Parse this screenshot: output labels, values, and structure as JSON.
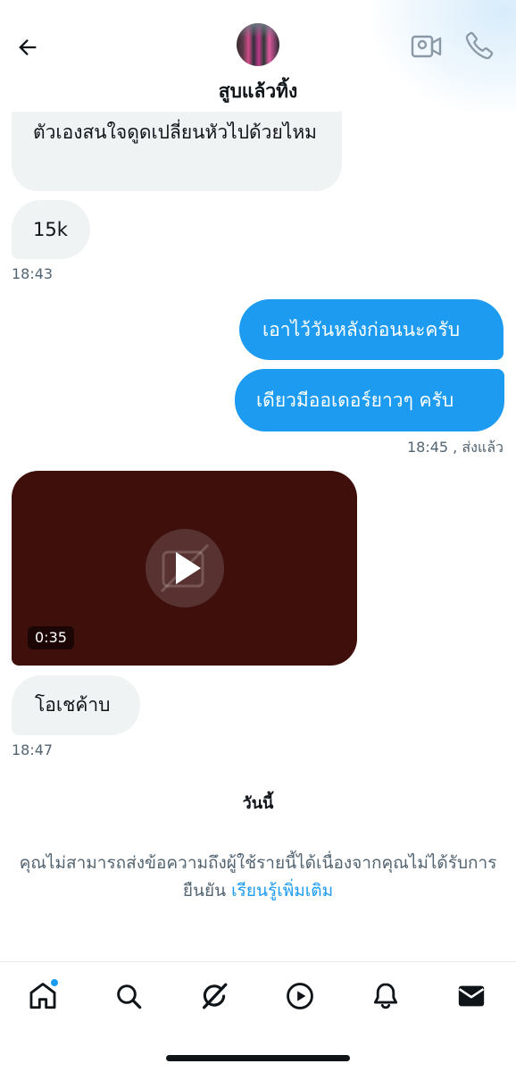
{
  "header": {
    "contact_name": "สูบแล้วทิ้ง",
    "back_icon": "arrow-left-icon",
    "video_call_icon": "video-camera-icon",
    "phone_icon": "phone-icon",
    "accent_color": "#1d9bf0"
  },
  "messages": [
    {
      "direction": "received",
      "text": "ตัวเองสนใจดูดเปลี่ยนหัวไปด้วยไหม"
    },
    {
      "direction": "received",
      "text": "15k",
      "time": "18:43"
    },
    {
      "direction": "sent",
      "text": "เอาไว้วันหลังก่อนนะครับ"
    },
    {
      "direction": "sent",
      "text": "เดียวมีออเดอร์ยาวๆ ครับ",
      "time": "18:45 , ส่งแล้ว"
    },
    {
      "direction": "received",
      "type": "video",
      "duration": "0:35"
    },
    {
      "direction": "received",
      "text": "โอเชค้าบ",
      "time": "18:47"
    }
  ],
  "date_separator": "วันนี้",
  "notice": {
    "text": "คุณไม่สามารถส่งข้อความถึงผู้ใช้รายนี้ได้เนื่องจากคุณไม่ได้รับการยืนยัน",
    "link": "เรียนรู้เพิ่มเติม"
  },
  "bottom_nav": {
    "items": [
      {
        "icon": "home-icon",
        "has_notification": true
      },
      {
        "icon": "search-icon"
      },
      {
        "icon": "grok-icon"
      },
      {
        "icon": "video-play-icon"
      },
      {
        "icon": "bell-icon"
      },
      {
        "icon": "mail-icon",
        "active": true
      }
    ]
  }
}
